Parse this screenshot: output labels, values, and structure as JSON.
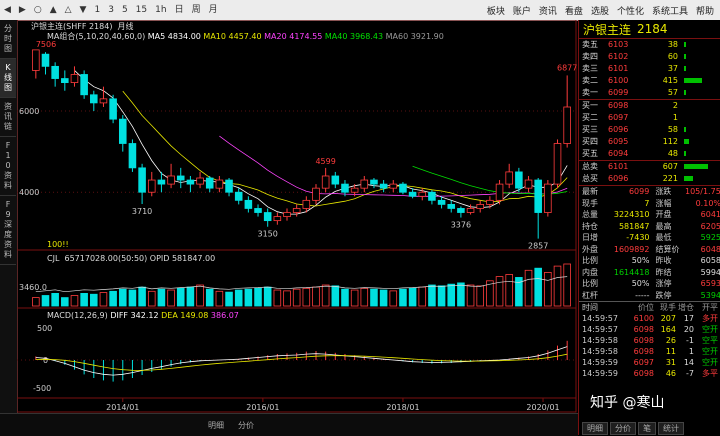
{
  "toolbar": {
    "buttons": [
      "◀",
      "▶",
      "○",
      "▲",
      "△",
      "▼",
      "1",
      "3",
      "5",
      "15",
      "1h",
      "日",
      "周",
      "月"
    ],
    "menus": [
      "板块",
      "账户",
      "资讯",
      "看盘",
      "选股",
      "个性化",
      "系统工具",
      "帮助"
    ]
  },
  "sidetabs": [
    "分时图",
    "K线图",
    "资讯链",
    "F10资料",
    "F9深度资料"
  ],
  "chart": {
    "symbol": "沪银主连(SHFF 2184)",
    "period": "月线",
    "ma_title": "MA组合(5,10,20,40,60,0)",
    "ma": [
      {
        "label": "MA5 4834.00",
        "color": "#ffffff"
      },
      {
        "label": "MA10 4457.40",
        "color": "#e8e800"
      },
      {
        "label": "MA20 4174.55",
        "color": "#ff44ff"
      },
      {
        "label": "MA40 3968.43",
        "color": "#00e000"
      },
      {
        "label": "MA60 3921.90",
        "color": "#999999"
      }
    ],
    "price_axis": [
      "6000",
      "4000"
    ],
    "annotations": {
      "hi1": "7506",
      "hi2": "6877",
      "low1": "3710",
      "low2": "3150",
      "mid": "4599",
      "low3": "3376",
      "low4": "2857"
    },
    "bottom_label": "100!!",
    "vol_header": "CJL",
    "vol_values": "65717028.00(50:50)  OPID 581847.00",
    "vol_axis": "3460.0",
    "macd_header": "MACD(12,26,9)",
    "macd_values": [
      {
        "label": "DIFF 342.12",
        "color": "#ffffff"
      },
      {
        "label": "DEA 149.08",
        "color": "#e8e800"
      },
      {
        "label": "386.07",
        "color": "#ff44ff"
      }
    ],
    "macd_axis": [
      "500",
      "0",
      "-500"
    ],
    "date_axis": [
      "2014/01",
      "2016/01",
      "2018/01",
      "2020/01"
    ],
    "candles": [
      {
        "o": 7000,
        "c": 7506,
        "h": 7506,
        "l": 6800
      },
      {
        "o": 7400,
        "c": 7100,
        "h": 7450,
        "l": 6900
      },
      {
        "o": 7100,
        "c": 6800,
        "h": 7200,
        "l": 6600
      },
      {
        "o": 6800,
        "c": 6700,
        "h": 7000,
        "l": 6500
      },
      {
        "o": 6700,
        "c": 6900,
        "h": 7100,
        "l": 6600
      },
      {
        "o": 6900,
        "c": 6400,
        "h": 7000,
        "l": 6300
      },
      {
        "o": 6400,
        "c": 6200,
        "h": 6500,
        "l": 6000
      },
      {
        "o": 6200,
        "c": 6300,
        "h": 6600,
        "l": 6100
      },
      {
        "o": 6300,
        "c": 5800,
        "h": 6400,
        "l": 5700
      },
      {
        "o": 5800,
        "c": 5200,
        "h": 5900,
        "l": 5000
      },
      {
        "o": 5200,
        "c": 4600,
        "h": 5300,
        "l": 4500
      },
      {
        "o": 4600,
        "c": 4000,
        "h": 4700,
        "l": 3710
      },
      {
        "o": 4000,
        "c": 4300,
        "h": 4500,
        "l": 3900
      },
      {
        "o": 4300,
        "c": 4200,
        "h": 4500,
        "l": 4000
      },
      {
        "o": 4200,
        "c": 4400,
        "h": 4700,
        "l": 4100
      },
      {
        "o": 4400,
        "c": 4300,
        "h": 4600,
        "l": 4100
      },
      {
        "o": 4300,
        "c": 4200,
        "h": 4400,
        "l": 4000
      },
      {
        "o": 4200,
        "c": 4350,
        "h": 4500,
        "l": 4100
      },
      {
        "o": 4350,
        "c": 4100,
        "h": 4400,
        "l": 4000
      },
      {
        "o": 4100,
        "c": 4300,
        "h": 4400,
        "l": 4000
      },
      {
        "o": 4300,
        "c": 4000,
        "h": 4350,
        "l": 3900
      },
      {
        "o": 4000,
        "c": 3800,
        "h": 4100,
        "l": 3700
      },
      {
        "o": 3800,
        "c": 3600,
        "h": 3900,
        "l": 3500
      },
      {
        "o": 3600,
        "c": 3500,
        "h": 3700,
        "l": 3400
      },
      {
        "o": 3500,
        "c": 3300,
        "h": 3600,
        "l": 3150
      },
      {
        "o": 3300,
        "c": 3400,
        "h": 3500,
        "l": 3200
      },
      {
        "o": 3400,
        "c": 3500,
        "h": 3600,
        "l": 3300
      },
      {
        "o": 3500,
        "c": 3600,
        "h": 3700,
        "l": 3400
      },
      {
        "o": 3600,
        "c": 3800,
        "h": 3900,
        "l": 3500
      },
      {
        "o": 3800,
        "c": 4100,
        "h": 4200,
        "l": 3700
      },
      {
        "o": 4100,
        "c": 4400,
        "h": 4599,
        "l": 4000
      },
      {
        "o": 4400,
        "c": 4200,
        "h": 4500,
        "l": 4100
      },
      {
        "o": 4200,
        "c": 4000,
        "h": 4300,
        "l": 3900
      },
      {
        "o": 4000,
        "c": 4100,
        "h": 4200,
        "l": 3900
      },
      {
        "o": 4100,
        "c": 4300,
        "h": 4400,
        "l": 4000
      },
      {
        "o": 4300,
        "c": 4200,
        "h": 4350,
        "l": 4100
      },
      {
        "o": 4200,
        "c": 4100,
        "h": 4300,
        "l": 4000
      },
      {
        "o": 4100,
        "c": 4200,
        "h": 4300,
        "l": 4000
      },
      {
        "o": 4200,
        "c": 4000,
        "h": 4250,
        "l": 3950
      },
      {
        "o": 4000,
        "c": 3900,
        "h": 4100,
        "l": 3850
      },
      {
        "o": 3900,
        "c": 4000,
        "h": 4100,
        "l": 3800
      },
      {
        "o": 4000,
        "c": 3800,
        "h": 4050,
        "l": 3700
      },
      {
        "o": 3800,
        "c": 3700,
        "h": 3900,
        "l": 3600
      },
      {
        "o": 3700,
        "c": 3600,
        "h": 3800,
        "l": 3500
      },
      {
        "o": 3600,
        "c": 3500,
        "h": 3650,
        "l": 3376
      },
      {
        "o": 3500,
        "c": 3600,
        "h": 3700,
        "l": 3450
      },
      {
        "o": 3600,
        "c": 3700,
        "h": 3800,
        "l": 3500
      },
      {
        "o": 3700,
        "c": 3800,
        "h": 3900,
        "l": 3600
      },
      {
        "o": 3800,
        "c": 4200,
        "h": 4300,
        "l": 3700
      },
      {
        "o": 4200,
        "c": 4500,
        "h": 4700,
        "l": 4100
      },
      {
        "o": 4500,
        "c": 4100,
        "h": 4600,
        "l": 4000
      },
      {
        "o": 4100,
        "c": 4300,
        "h": 4400,
        "l": 4000
      },
      {
        "o": 4300,
        "c": 3500,
        "h": 4350,
        "l": 2857
      },
      {
        "o": 3500,
        "c": 4200,
        "h": 4300,
        "l": 3400
      },
      {
        "o": 4200,
        "c": 5200,
        "h": 5300,
        "l": 4100
      },
      {
        "o": 5200,
        "c": 6099,
        "h": 6877,
        "l": 5100
      }
    ],
    "volumes": [
      0.2,
      0.25,
      0.3,
      0.2,
      0.25,
      0.3,
      0.28,
      0.32,
      0.35,
      0.4,
      0.38,
      0.45,
      0.35,
      0.4,
      0.38,
      0.42,
      0.45,
      0.5,
      0.4,
      0.35,
      0.33,
      0.38,
      0.4,
      0.42,
      0.45,
      0.38,
      0.36,
      0.4,
      0.42,
      0.45,
      0.5,
      0.48,
      0.4,
      0.38,
      0.42,
      0.4,
      0.38,
      0.36,
      0.4,
      0.42,
      0.45,
      0.5,
      0.48,
      0.52,
      0.55,
      0.5,
      0.48,
      0.6,
      0.7,
      0.75,
      0.68,
      0.85,
      0.9,
      0.8,
      0.95,
      1.0
    ],
    "macd": [
      60,
      40,
      -20,
      -80,
      -160,
      -240,
      -300,
      -340,
      -360,
      -340,
      -300,
      -250,
      -200,
      -160,
      -110,
      -70,
      -40,
      -20,
      -10,
      0,
      10,
      20,
      40,
      60,
      80,
      100,
      110,
      120,
      140,
      150,
      140,
      120,
      100,
      80,
      60,
      40,
      20,
      0,
      -20,
      -40,
      -50,
      -60,
      -55,
      -50,
      -40,
      -30,
      -20,
      -10,
      0,
      20,
      40,
      60,
      100,
      160,
      240,
      320
    ]
  },
  "price_panel": {
    "title_name": "沪银主连",
    "title_code": "2184",
    "asks": [
      {
        "label": "卖五",
        "price": "6103",
        "vol": "38",
        "bar": 0.05
      },
      {
        "label": "卖四",
        "price": "6102",
        "vol": "60",
        "bar": 0.07
      },
      {
        "label": "卖三",
        "price": "6101",
        "vol": "37",
        "bar": 0.05
      },
      {
        "label": "卖二",
        "price": "6100",
        "vol": "415",
        "bar": 0.6
      },
      {
        "label": "卖一",
        "price": "6099",
        "vol": "57",
        "bar": 0.07
      }
    ],
    "bids": [
      {
        "label": "买一",
        "price": "6098",
        "vol": "2",
        "bar": 0.0
      },
      {
        "label": "买二",
        "price": "6097",
        "vol": "1",
        "bar": 0.0
      },
      {
        "label": "买三",
        "price": "6096",
        "vol": "58",
        "bar": 0.07
      },
      {
        "label": "买四",
        "price": "6095",
        "vol": "112",
        "bar": 0.15
      },
      {
        "label": "买五",
        "price": "6094",
        "vol": "48",
        "bar": 0.06
      }
    ],
    "totals": [
      {
        "label": "总卖",
        "price": "6101",
        "vol": "607",
        "bar": 0.8
      },
      {
        "label": "总买",
        "price": "6096",
        "vol": "221",
        "bar": 0.3
      }
    ],
    "stats": [
      {
        "l1": "最新",
        "v1": "6099",
        "c1": "red",
        "l2": "涨跌",
        "v2": "105/1.75%",
        "c2": "red"
      },
      {
        "l1": "现手",
        "v1": "7",
        "c1": "yellow",
        "l2": "涨幅",
        "v2": "0.10%",
        "c2": "red"
      },
      {
        "l1": "总量",
        "v1": "3224310",
        "c1": "yellow",
        "l2": "开盘",
        "v2": "6041",
        "c2": "red"
      },
      {
        "l1": "持仓",
        "v1": "581847",
        "c1": "yellow",
        "l2": "最高",
        "v2": "6205",
        "c2": "red"
      },
      {
        "l1": "日增",
        "v1": "-7430",
        "c1": "yellow",
        "l2": "最低",
        "v2": "5925",
        "c2": "green"
      },
      {
        "l1": "外盘",
        "v1": "1609892",
        "c1": "red",
        "l2": "结算价",
        "v2": "6048",
        "c2": "red"
      },
      {
        "l1": "比例",
        "v1": "50%",
        "c1": "white",
        "l2": "昨收",
        "v2": "6058",
        "c2": "white"
      },
      {
        "l1": "内盘",
        "v1": "1614418",
        "c1": "green",
        "l2": "昨结",
        "v2": "5994",
        "c2": "white"
      },
      {
        "l1": "比例",
        "v1": "50%",
        "c1": "white",
        "l2": "涨停",
        "v2": "6593",
        "c2": "red"
      },
      {
        "l1": "杠杆",
        "v1": "-----",
        "c1": "white",
        "l2": "跌停",
        "v2": "5394",
        "c2": "green"
      }
    ],
    "tick_headers": [
      "时间",
      "价位",
      "现手",
      "增仓",
      "开平"
    ],
    "ticks": [
      {
        "t": "14:59:57",
        "p": "6100",
        "v": "207",
        "d": "17",
        "f": "多开"
      },
      {
        "t": "14:59:57",
        "p": "6098",
        "v": "164",
        "d": "20",
        "f": "空开"
      },
      {
        "t": "14:59:58",
        "p": "6098",
        "v": "26",
        "d": "-1",
        "f": "空平"
      },
      {
        "t": "14:59:58",
        "p": "6098",
        "v": "11",
        "d": "1",
        "f": "空开"
      },
      {
        "t": "14:59:59",
        "p": "6097",
        "v": "31",
        "d": "14",
        "f": "空开"
      },
      {
        "t": "14:59:59",
        "p": "6098",
        "v": "46",
        "d": "-7",
        "f": "多平"
      }
    ],
    "bottom_tabs": [
      "明细",
      "分价",
      "笔",
      "统计"
    ]
  },
  "bottom_tabs": [
    "明细",
    "分价"
  ],
  "watermark": "知乎 @寒山"
}
